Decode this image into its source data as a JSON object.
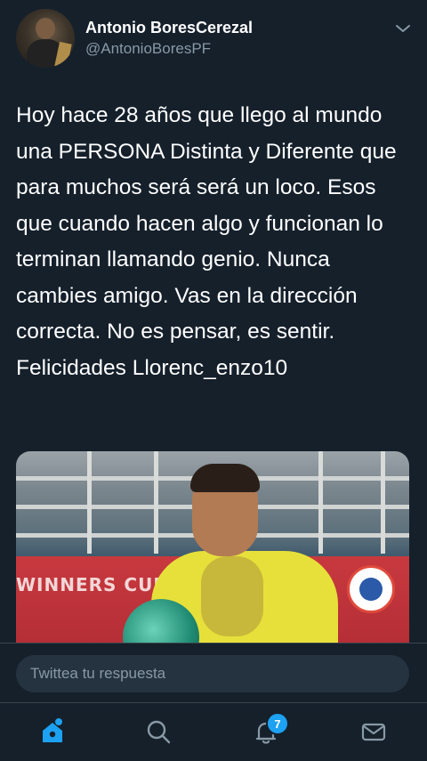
{
  "tweet": {
    "author_name": "Antonio BoresCerezal",
    "author_handle": "@AntonioBoresPF",
    "text": "Hoy hace 28 años que llego al mundo una PERSONA Distinta y Diferente que para muchos será será un loco. Esos que cuando hacen algo y funcionan lo terminan llamando genio. Nunca cambies amigo. Vas en la dirección correcta. No es pensar, es sentir. Felicidades Llorenc_enzo10",
    "media_banner_text": "WINNERS CUP–AL"
  },
  "reply": {
    "placeholder": "Twittea tu respuesta"
  },
  "tabbar": {
    "notifications_badge": "7",
    "icons": [
      "home-icon",
      "search-icon",
      "notifications-icon",
      "messages-icon"
    ]
  },
  "colors": {
    "background": "#15202b",
    "accent": "#1da1f2",
    "secondary_text": "#8899a6"
  }
}
